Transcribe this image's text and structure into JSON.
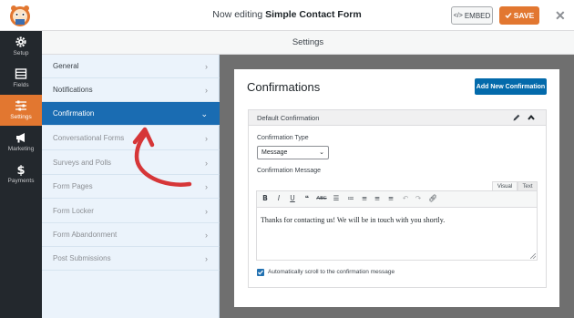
{
  "topbar": {
    "title_prefix": "Now editing ",
    "form_name": "Simple Contact Form",
    "embed_label": "EMBED",
    "save_label": "SAVE",
    "close_glyph": "✕"
  },
  "rail": {
    "items": [
      {
        "label": "Setup",
        "icon": "gear-icon"
      },
      {
        "label": "Fields",
        "icon": "fields-icon"
      },
      {
        "label": "Settings",
        "icon": "sliders-icon",
        "active": true
      },
      {
        "label": "Marketing",
        "icon": "megaphone-icon"
      },
      {
        "label": "Payments",
        "icon": "dollar-icon"
      }
    ]
  },
  "settings_header": "Settings",
  "panel": {
    "items": [
      {
        "label": "General",
        "state": "normal"
      },
      {
        "label": "Notifications",
        "state": "normal"
      },
      {
        "label": "Confirmation",
        "state": "active"
      },
      {
        "label": "Conversational Forms",
        "state": "disabled"
      },
      {
        "label": "Surveys and Polls",
        "state": "disabled"
      },
      {
        "label": "Form Pages",
        "state": "disabled"
      },
      {
        "label": "Form Locker",
        "state": "disabled"
      },
      {
        "label": "Form Abandonment",
        "state": "disabled"
      },
      {
        "label": "Post Submissions",
        "state": "disabled"
      }
    ]
  },
  "content": {
    "title": "Confirmations",
    "add_button": "Add New Confirmation",
    "box_title": "Default Confirmation",
    "type_label": "Confirmation Type",
    "type_value": "Message",
    "message_label": "Confirmation Message",
    "tab_visual": "Visual",
    "tab_text": "Text",
    "message_text": "Thanks for contacting us! We will be in touch with you shortly.",
    "scroll_label": "Automatically scroll to the confirmation message",
    "scroll_checked": true
  },
  "colors": {
    "accent": "#e27730",
    "active_panel": "#1a6cb2",
    "button_blue": "#036aab",
    "rail": "#23282d",
    "arrow": "#d63638"
  }
}
